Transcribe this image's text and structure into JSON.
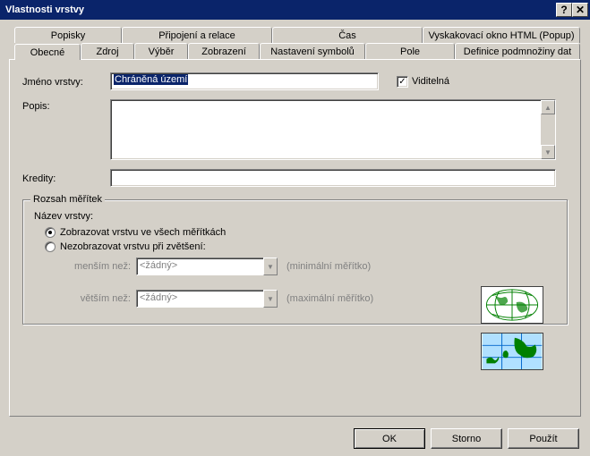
{
  "title": "Vlastnosti vrstvy",
  "tabs_row1": {
    "t0": "Popisky",
    "t1": "Připojení a relace",
    "t2": "Čas",
    "t3": "Vyskakovací okno HTML (Popup)"
  },
  "tabs_row2": {
    "t0": "Obecné",
    "t1": "Zdroj",
    "t2": "Výběr",
    "t3": "Zobrazení",
    "t4": "Nastavení symbolů",
    "t5": "Pole",
    "t6": "Definice podmnožiny dat"
  },
  "fields": {
    "layer_name_label": "Jméno vrstvy:",
    "layer_name_value": "Chráněná území",
    "visible_label": "Viditelná",
    "popis_label": "Popis:",
    "kredity_label": "Kredity:"
  },
  "scalebox": {
    "title": "Rozsah měřítek",
    "subheading": "Název vrstvy:",
    "radio1": "Zobrazovat vrstvu ve všech měřítkách",
    "radio2": "Nezobrazovat vrstvu při zvětšení:",
    "min_label": "menším než:",
    "max_label": "větším než:",
    "none": "<žádný>",
    "min_hint": "(minimální měřítko)",
    "max_hint": "(maximální měřítko)"
  },
  "buttons": {
    "ok": "OK",
    "cancel": "Storno",
    "apply": "Použít"
  }
}
